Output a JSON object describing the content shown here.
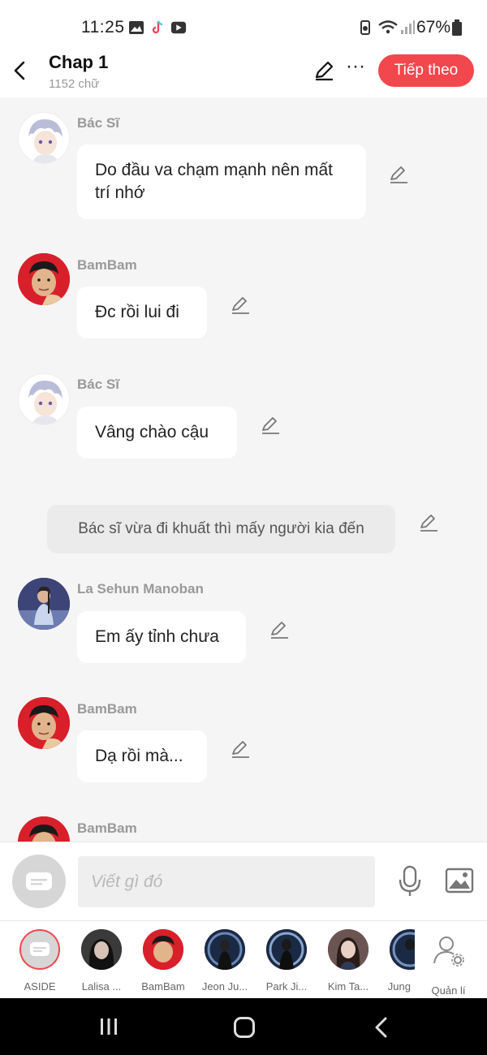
{
  "status": {
    "time": "11:25",
    "battery": "67%"
  },
  "header": {
    "title": "Chap 1",
    "subtitle": "1152 chữ",
    "next_label": "Tiếp theo"
  },
  "messages": [
    {
      "speaker": "Bác Sĩ",
      "text": "Do đầu va chạm mạnh nên mất trí nhớ"
    },
    {
      "speaker": "BamBam",
      "text": "Đc rồi lui đi"
    },
    {
      "speaker": "Bác Sĩ",
      "text": "Vâng chào cậu"
    },
    {
      "narration": "Bác sĩ vừa đi khuất thì mấy người kia đến"
    },
    {
      "speaker": "La Sehun Manoban",
      "text": "Em ấy tỉnh chưa"
    },
    {
      "speaker": "BamBam",
      "text": "Dạ rồi mà..."
    },
    {
      "speaker": "BamBam"
    }
  ],
  "composer": {
    "placeholder": "Viết gì đó"
  },
  "characters": [
    {
      "label": "ASIDE"
    },
    {
      "label": "Lalisa ..."
    },
    {
      "label": "BamBam"
    },
    {
      "label": "Jeon Ju..."
    },
    {
      "label": "Park Ji..."
    },
    {
      "label": "Kim Ta..."
    },
    {
      "label": "Jung"
    }
  ],
  "manage_label": "Quản lí",
  "colors": {
    "accent": "#f2474d",
    "bubble": "#ffffff",
    "background": "#f5f5f5"
  }
}
